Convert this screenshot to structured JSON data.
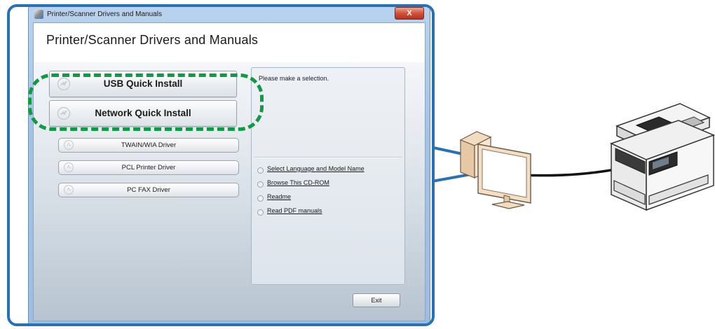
{
  "window": {
    "title": "Printer/Scanner Drivers and Manuals",
    "close_glyph": "X"
  },
  "header": {
    "title": "Printer/Scanner Drivers and Manuals"
  },
  "main_buttons": [
    {
      "label": "USB Quick Install",
      "icon": "install-icon"
    },
    {
      "label": "Network Quick Install",
      "icon": "install-icon"
    }
  ],
  "driver_buttons": [
    {
      "label": "TWAIN/WIA Driver",
      "icon": "driver-icon"
    },
    {
      "label": "PCL Printer Driver",
      "icon": "driver-icon"
    },
    {
      "label": "PC FAX Driver",
      "icon": "driver-icon"
    }
  ],
  "info_panel": {
    "message": "Please make a selection.",
    "links": [
      "Select Language and Model Name",
      "Browse This CD-ROM",
      "Readme",
      "Read PDF manuals"
    ]
  },
  "footer": {
    "exit_label": "Exit"
  },
  "colors": {
    "frame": "#2872b4",
    "highlight": "#119a45",
    "close_button": "#c8442c"
  }
}
